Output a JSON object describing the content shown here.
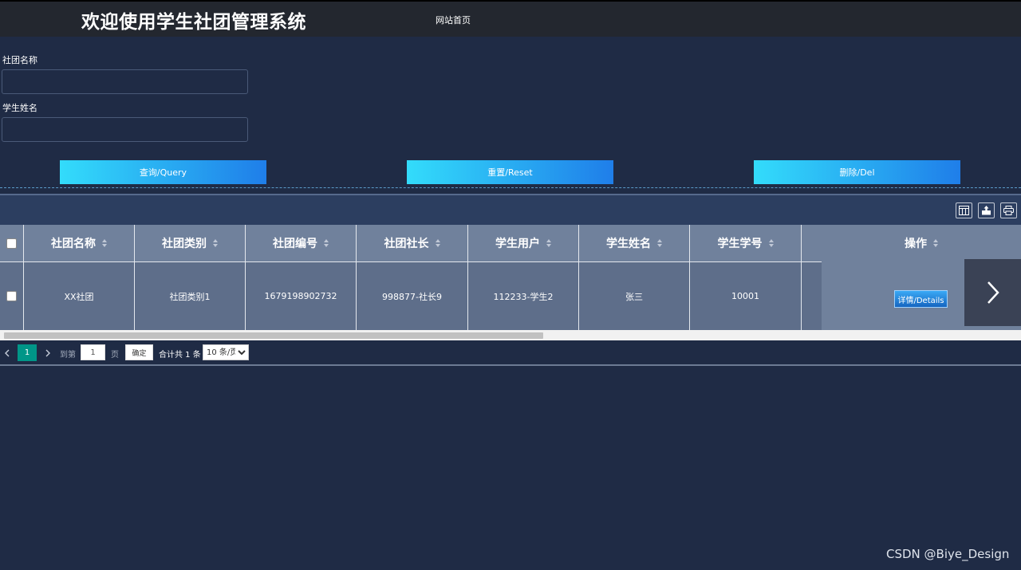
{
  "header": {
    "title": "欢迎使用学生社团管理系统",
    "nav_home": "网站首页"
  },
  "search": {
    "club_name_label": "社团名称",
    "club_name_value": "",
    "student_name_label": "学生姓名",
    "student_name_value": ""
  },
  "actions": {
    "query": "查询/Query",
    "reset": "重置/Reset",
    "delete": "删除/Del"
  },
  "table": {
    "columns": [
      "社团名称",
      "社团类别",
      "社团编号",
      "社团社长",
      "学生用户",
      "学生姓名",
      "学生学号",
      "",
      "操作"
    ],
    "rows": [
      {
        "club_name": "XX社团",
        "club_type": "社团类别1",
        "club_no": "1679198902732",
        "president": "998877-社长9",
        "student_user": "112233-学生2",
        "student_name": "张三",
        "student_no": "10001",
        "detail_label": "详情/Details"
      }
    ]
  },
  "pagination": {
    "current": "1",
    "goto_prefix": "到第",
    "goto_value": "1",
    "goto_suffix": "页",
    "confirm": "确定",
    "total": "合计共 1 条",
    "page_size": "10 条/页"
  },
  "watermark": "CSDN @Biye_Design",
  "colors": {
    "background": "#1f2b45",
    "topbar": "#23272f",
    "button_gradient_start": "#33dcfb",
    "button_gradient_end": "#1f7ee9",
    "pager_active": "#009688"
  }
}
